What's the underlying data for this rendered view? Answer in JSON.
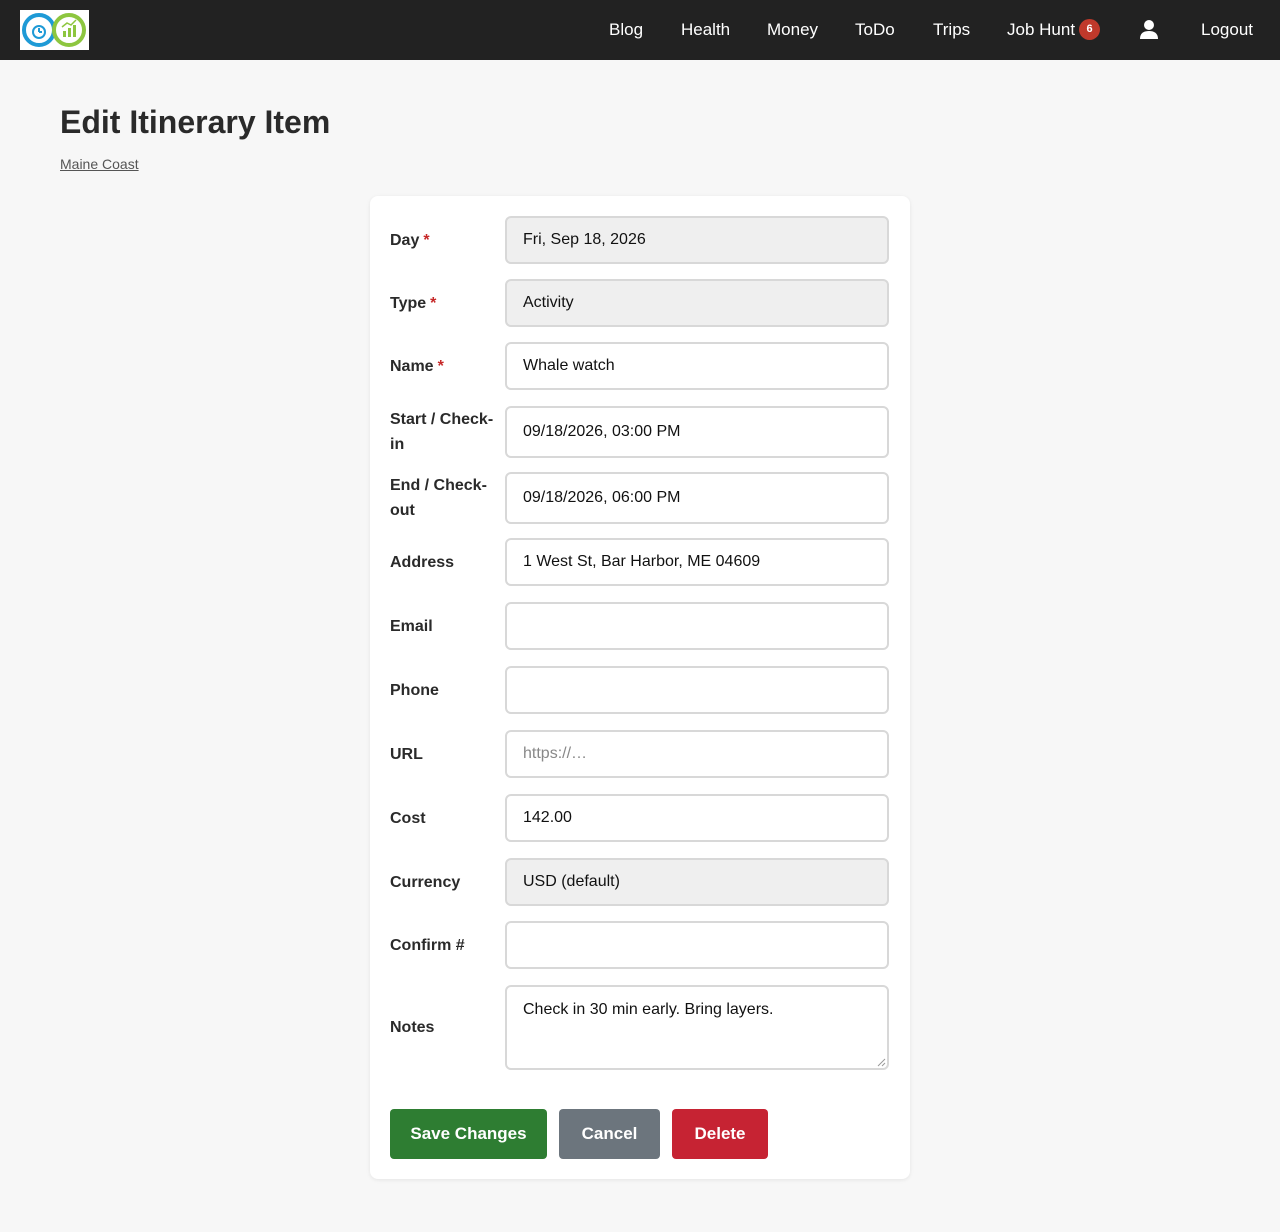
{
  "nav": {
    "links": [
      "Blog",
      "Health",
      "Money",
      "ToDo",
      "Trips",
      "Job Hunt"
    ],
    "job_hunt_badge": "6",
    "logout": "Logout"
  },
  "page": {
    "title": "Edit Itinerary Item",
    "breadcrumb": "Maine Coast"
  },
  "form": {
    "fields": [
      {
        "label": "Day",
        "required": true,
        "value": "Fri, Sep 18, 2026",
        "readonly": true
      },
      {
        "label": "Type",
        "required": true,
        "value": "Activity",
        "readonly": true
      },
      {
        "label": "Name",
        "required": true,
        "value": "Whale watch"
      },
      {
        "label": "Start / Check-in",
        "value": "09/18/2026, 03:00 PM"
      },
      {
        "label": "End / Check-out",
        "value": "09/18/2026, 06:00 PM"
      },
      {
        "label": "Address",
        "value": "1 West St, Bar Harbor, ME 04609"
      },
      {
        "label": "Email",
        "value": ""
      },
      {
        "label": "Phone",
        "value": ""
      },
      {
        "label": "URL",
        "value": "",
        "placeholder": "https://…"
      },
      {
        "label": "Cost",
        "value": "142.00"
      },
      {
        "label": "Currency",
        "value": "USD (default)",
        "readonly": true
      },
      {
        "label": "Confirm #",
        "value": ""
      },
      {
        "label": "Notes",
        "value": "Check in 30 min early. Bring layers."
      }
    ],
    "required_marker": "*",
    "buttons": {
      "save": "Save Changes",
      "cancel": "Cancel",
      "delete": "Delete"
    }
  },
  "colors": {
    "navbar_bg": "#222222",
    "save": "#2e7d32",
    "cancel": "#6c757d",
    "delete": "#c62333",
    "required": "#c62828",
    "badge": "#c0392b"
  },
  "icons": {
    "logo": "productivity-logo",
    "user": "user-icon"
  }
}
